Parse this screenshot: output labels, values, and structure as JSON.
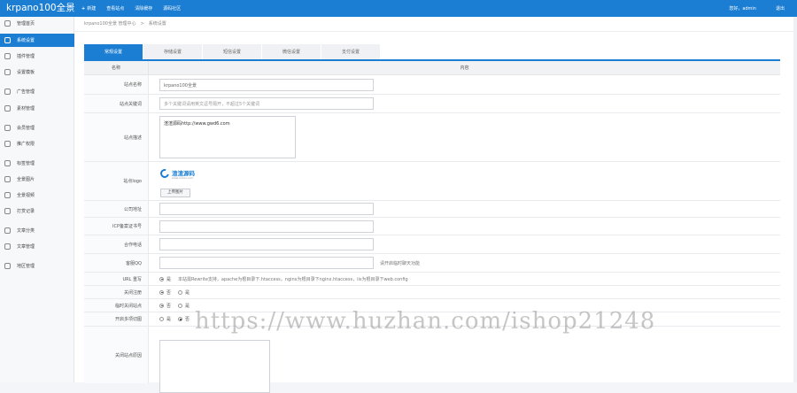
{
  "topbar": {
    "brand": "krpano100全景",
    "nav": [
      "新建",
      "查看站点",
      "清除缓存",
      "源码社区"
    ],
    "greeting": "您好，admin",
    "logout": "退出"
  },
  "sidebar": {
    "items": [
      {
        "label": "管理首页",
        "active": false
      },
      {
        "label": "系统设置",
        "active": true
      },
      {
        "label": "插件管理",
        "active": false
      },
      {
        "label": "设置模板",
        "active": false
      },
      {
        "label": "广告管理",
        "active": false
      },
      {
        "label": "素材管理",
        "active": false
      },
      {
        "label": "会员管理",
        "active": false
      },
      {
        "label": "推广权限",
        "active": false
      },
      {
        "label": "标签管理",
        "active": false
      },
      {
        "label": "全景图片",
        "active": false
      },
      {
        "label": "全景视频",
        "active": false
      },
      {
        "label": "打赏记录",
        "active": false
      },
      {
        "label": "文章分类",
        "active": false
      },
      {
        "label": "文章管理",
        "active": false
      },
      {
        "label": "地区管理",
        "active": false
      }
    ]
  },
  "breadcrumb": {
    "root": "krpano100全景 管理中心",
    "sep": ">",
    "current": "系统设置"
  },
  "tabs": [
    "常规设置",
    "存储设置",
    "短信设置",
    "微信设置",
    "支付设置"
  ],
  "table": {
    "col_name": "名称",
    "col_content": "内容"
  },
  "form": {
    "site_name": {
      "label": "站点名称",
      "value": "krpano100全景"
    },
    "keywords": {
      "label": "站点关键词",
      "value": "多个关键词请用英文逗号隔开，不超过5个关键词"
    },
    "description": {
      "label": "站点描述",
      "value": "渲渲源码http://www.gwd6.com"
    },
    "logo": {
      "label": "站点logo",
      "logo_text": "渲渲源码",
      "logo_sub": "www.xxxxx.com",
      "upload": "上传图片"
    },
    "address": {
      "label": "公司地址",
      "value": ""
    },
    "icp": {
      "label": "ICP备案证书号",
      "value": ""
    },
    "phone": {
      "label": "合作电话",
      "value": ""
    },
    "qq": {
      "label": "客服QQ",
      "value": "",
      "tip": "请开启临时聊天功能"
    },
    "rewrite": {
      "label": "URL 重写",
      "option": "是",
      "tip": "本站需Rewrite支持，apache为根目录下.htaccess，nginx为根目录下nginx.htaccess，iis为根目录下web.config"
    },
    "register": {
      "label": "关闭注册",
      "options": [
        "否",
        "是"
      ],
      "selected": 0
    },
    "close_site": {
      "label": "临时关闭站点",
      "options": [
        "否",
        "是"
      ],
      "selected": 0
    },
    "multi_cut": {
      "label": "开启多项切图",
      "options": [
        "是",
        "否"
      ],
      "selected": 1
    },
    "close_reason": {
      "label": "关闭站点原因",
      "value": ""
    }
  },
  "watermark": "https://www.huzhan.com/ishop21248"
}
